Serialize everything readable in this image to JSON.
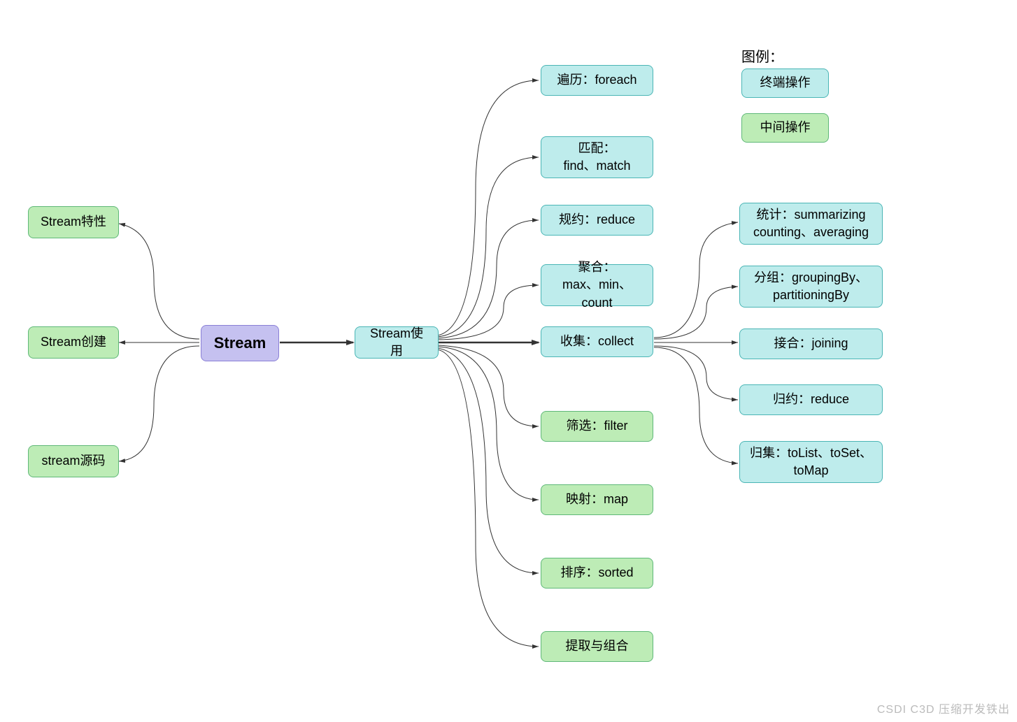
{
  "root": {
    "label": "Stream"
  },
  "left": [
    {
      "label": "Stream特性"
    },
    {
      "label": "Stream创建"
    },
    {
      "label": "stream源码"
    }
  ],
  "usage": {
    "label": "Stream使用"
  },
  "terminal_ops": [
    {
      "label": "遍历：foreach"
    },
    {
      "label": "匹配：\nfind、match"
    },
    {
      "label": "规约：reduce"
    },
    {
      "label": "聚合：\nmax、min、count"
    },
    {
      "label": "收集：collect"
    }
  ],
  "intermediate_ops": [
    {
      "label": "筛选：filter"
    },
    {
      "label": "映射：map"
    },
    {
      "label": "排序：sorted"
    },
    {
      "label": "提取与组合"
    }
  ],
  "collect_ops": [
    {
      "label": "统计：summarizing\ncounting、averaging"
    },
    {
      "label": "分组：groupingBy、\npartitioningBy"
    },
    {
      "label": "接合：joining"
    },
    {
      "label": "归约：reduce"
    },
    {
      "label": "归集：toList、toSet、\ntoMap"
    }
  ],
  "legend": {
    "title": "图例：",
    "terminal": "终端操作",
    "intermediate": "中间操作"
  },
  "watermark": "CSDI C3D 压缩开发铁出"
}
